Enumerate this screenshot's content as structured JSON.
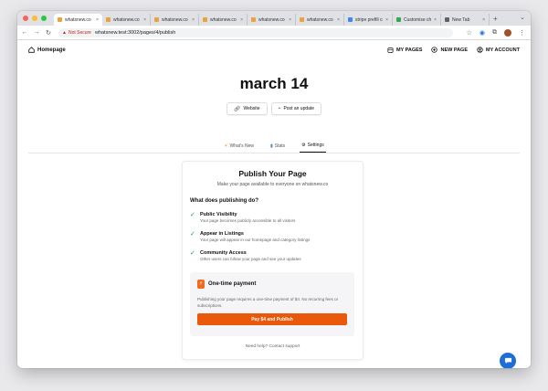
{
  "browser": {
    "tabs": [
      {
        "title": "whatsnew.co",
        "favicon_color": "#e8a33d",
        "active": true
      },
      {
        "title": "whatsnew.co",
        "favicon_color": "#e8a33d",
        "active": false
      },
      {
        "title": "whatsnew.co",
        "favicon_color": "#e8a33d",
        "active": false
      },
      {
        "title": "whatsnew.co",
        "favicon_color": "#e8a33d",
        "active": false
      },
      {
        "title": "whatsnew.co",
        "favicon_color": "#e8a33d",
        "active": false
      },
      {
        "title": "whatsnew.co",
        "favicon_color": "#e8a33d",
        "active": false
      },
      {
        "title": "stripe prefill cu",
        "favicon_color": "#4285f4",
        "active": false
      },
      {
        "title": "Customise chec",
        "favicon_color": "#34a853",
        "active": false
      },
      {
        "title": "New Tab",
        "favicon_color": "#5f6368",
        "active": false
      }
    ],
    "new_tab_symbol": "+",
    "security_label": "Not Secure",
    "url": "whatsnew.test:3002/pages/4/publish",
    "traffic_colors": [
      "#ff5f57",
      "#febc2e",
      "#28c840"
    ]
  },
  "nav": {
    "home_label": "Homepage",
    "my_pages": "MY PAGES",
    "new_page": "NEW PAGE",
    "my_account": "MY ACCOUNT"
  },
  "page": {
    "title": "march 14",
    "website_btn": "Website",
    "post_update_btn": "Post an update"
  },
  "tabs": {
    "whats_new": "What's New",
    "stats": "Stats",
    "settings": "Settings"
  },
  "card": {
    "title": "Publish Your Page",
    "subtitle": "Make your page available to everyone on whatsnew.co",
    "question": "What does publishing do?",
    "features": [
      {
        "title": "Public Visibility",
        "desc": "Your page becomes publicly accessible to all visitors"
      },
      {
        "title": "Appear in Listings",
        "desc": "Your page will appear in our homepage and category listings"
      },
      {
        "title": "Community Access",
        "desc": "Other users can follow your page and see your updates"
      }
    ],
    "payment": {
      "title": "One-time payment",
      "desc": "Publishing your page requires a one-time payment of $4. No recurring fees or subscriptions.",
      "button": "Pay $4 and Publish"
    },
    "help": "Need help? Contact support"
  },
  "colors": {
    "accent": "#ea580c",
    "check": "#16a34a",
    "chat": "#1d6fd6"
  }
}
